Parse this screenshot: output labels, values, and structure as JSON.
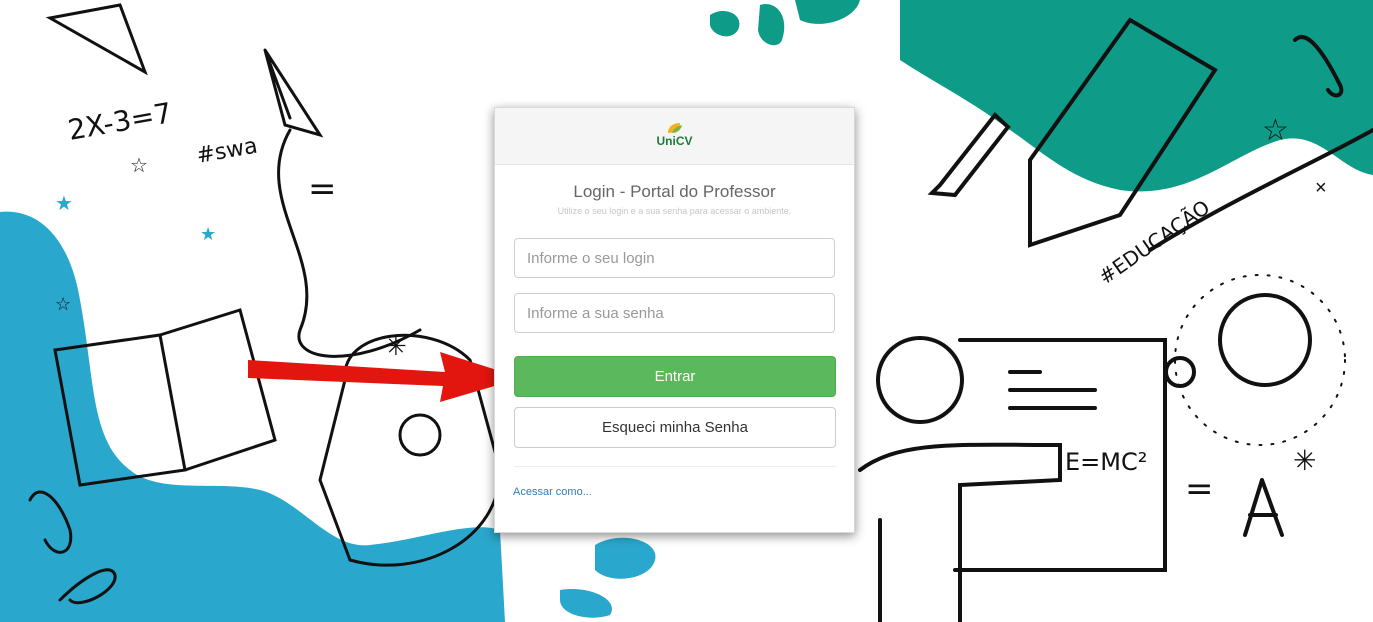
{
  "background": {
    "doodle_texts": [
      "2X-3=7",
      "#swa",
      "#EDUCAÇÃO",
      "E=MC²"
    ],
    "accent_colors": {
      "teal": "#0e9b87",
      "blue": "#2aa7cc",
      "arrow_red": "#e3160f"
    }
  },
  "login": {
    "logo_text": "UniCV",
    "title": "Login - Portal do Professor",
    "subtitle": "Utilize o seu login e a sua senha para acessar o ambiente.",
    "login_placeholder": "Informe o seu login",
    "password_placeholder": "Informe a sua senha",
    "submit_label": "Entrar",
    "forgot_label": "Esqueci minha Senha",
    "access_as_label": "Acessar como..."
  }
}
